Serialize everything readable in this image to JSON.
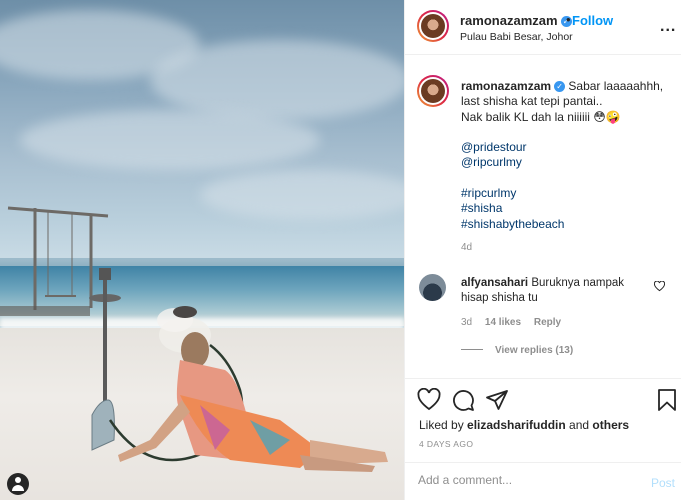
{
  "post": {
    "username": "ramonazamzam",
    "verified_icon": "verified-badge-icon",
    "follow_label": "Follow",
    "separator": "•",
    "location": "Pulau Babi Besar, Johor",
    "more_label": "..."
  },
  "caption": {
    "username": "ramonazamzam",
    "line1": "Sabar laaaaahhh,",
    "line2": "last shisha kat tepi pantai..",
    "line3": "Nak balik KL dah la niiiiii 😳🤪",
    "mentions": [
      "@pridestour",
      "@ripcurlmy"
    ],
    "hashtags": [
      "#ripcurlmy",
      "#shisha",
      "#shishabythebeach"
    ],
    "time": "4d"
  },
  "comment": {
    "username": "alfyansahari",
    "text": "Buruknya nampak hisap shisha tu",
    "time": "3d",
    "likes": "14 likes",
    "reply_label": "Reply",
    "view_replies": "View replies (13)"
  },
  "actions": {
    "liked_by_prefix": "Liked by ",
    "liked_by_user": "elizadsharifuddin",
    "liked_by_and": " and ",
    "liked_by_others": "others",
    "date": "4 DAYS AGO"
  },
  "add_comment": {
    "placeholder": "Add a comment...",
    "post_label": "Post"
  },
  "colors": {
    "accent": "#0095f6",
    "muted": "#8e8e8e",
    "text": "#262626"
  }
}
